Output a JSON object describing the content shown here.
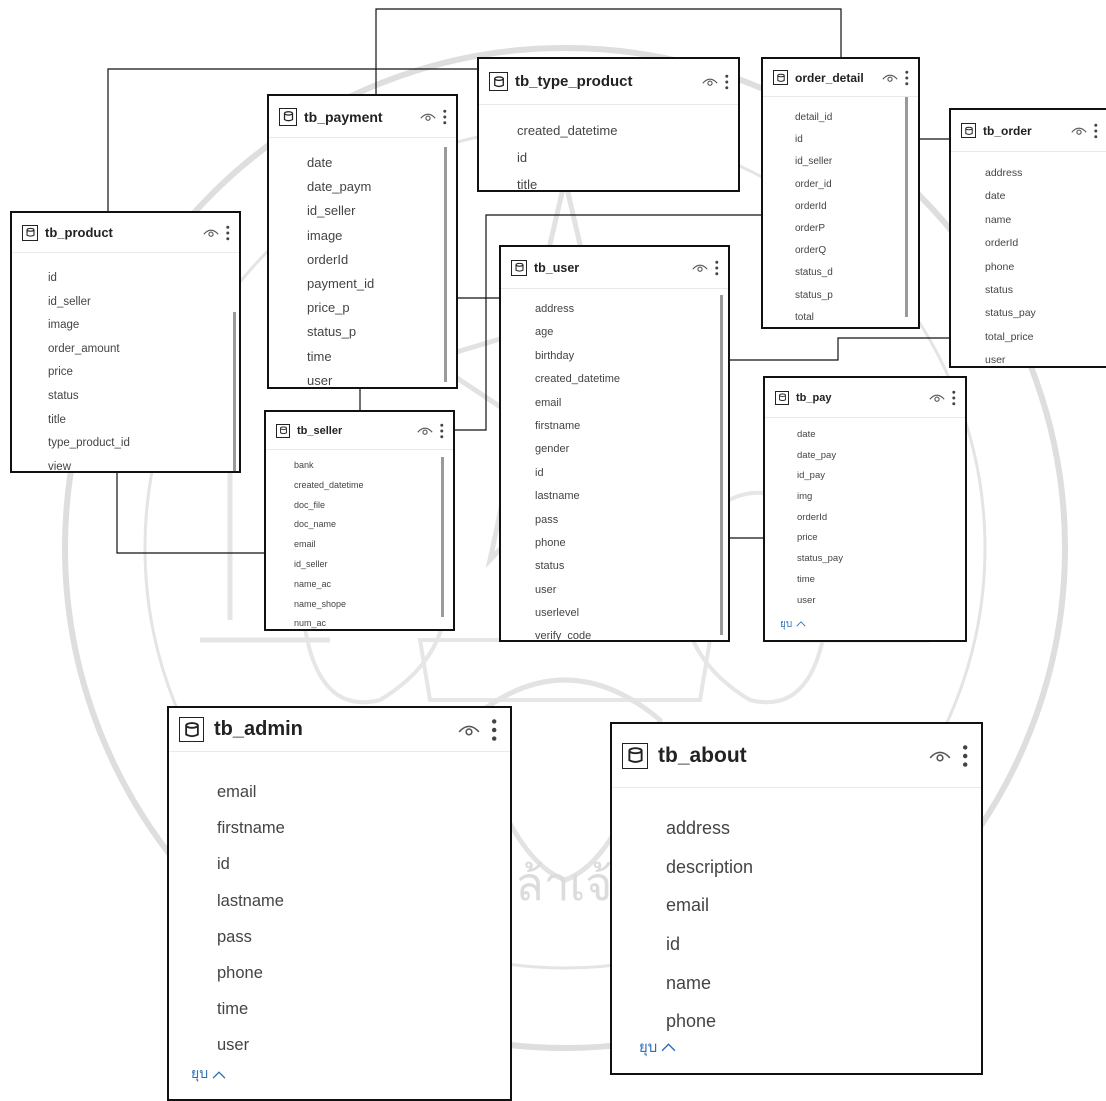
{
  "colors": {
    "border": "#111111",
    "line": "#111111",
    "link": "#2f6fb8",
    "watermark": "#d9d9d9"
  },
  "icons": {
    "table": "table-icon",
    "eye": "eye-icon",
    "more": "more-vert-icon",
    "collapse": "chevron-up-icon"
  },
  "collapse_label": "ยุบ",
  "watermark_text": "พระจอมเกล้าเจ้าคุณทหาร",
  "tables": {
    "tb_product": {
      "name": "tb_product",
      "fields": [
        "id",
        "id_seller",
        "image",
        "order_amount",
        "price",
        "status",
        "title",
        "type_product_id",
        "view"
      ]
    },
    "tb_payment": {
      "name": "tb_payment",
      "fields": [
        "date",
        "date_paym",
        "id_seller",
        "image",
        "orderId",
        "payment_id",
        "price_p",
        "status_p",
        "time",
        "user"
      ]
    },
    "tb_type_product": {
      "name": "tb_type_product",
      "fields": [
        "created_datetime",
        "id",
        "title"
      ]
    },
    "order_detail": {
      "name": "order_detail",
      "fields": [
        "detail_id",
        "id",
        "id_seller",
        "order_id",
        "orderId",
        "orderP",
        "orderQ",
        "status_d",
        "status_p",
        "total"
      ]
    },
    "tb_order": {
      "name": "tb_order",
      "fields": [
        "address",
        "date",
        "name",
        "orderId",
        "phone",
        "status",
        "status_pay",
        "total_price",
        "user"
      ]
    },
    "tb_user": {
      "name": "tb_user",
      "fields": [
        "address",
        "age",
        "birthday",
        "created_datetime",
        "email",
        "firstname",
        "gender",
        "id",
        "lastname",
        "pass",
        "phone",
        "status",
        "user",
        "userlevel",
        "verify_code"
      ]
    },
    "tb_seller": {
      "name": "tb_seller",
      "fields": [
        "bank",
        "created_datetime",
        "doc_file",
        "doc_name",
        "email",
        "id_seller",
        "name_ac",
        "name_shope",
        "num_ac"
      ]
    },
    "tb_pay": {
      "name": "tb_pay",
      "fields": [
        "date",
        "date_pay",
        "id_pay",
        "img",
        "orderId",
        "price",
        "status_pay",
        "time",
        "user"
      ]
    },
    "tb_admin": {
      "name": "tb_admin",
      "fields": [
        "email",
        "firstname",
        "id",
        "lastname",
        "pass",
        "phone",
        "time",
        "user"
      ]
    },
    "tb_about": {
      "name": "tb_about",
      "fields": [
        "address",
        "description",
        "email",
        "id",
        "name",
        "phone"
      ]
    }
  }
}
